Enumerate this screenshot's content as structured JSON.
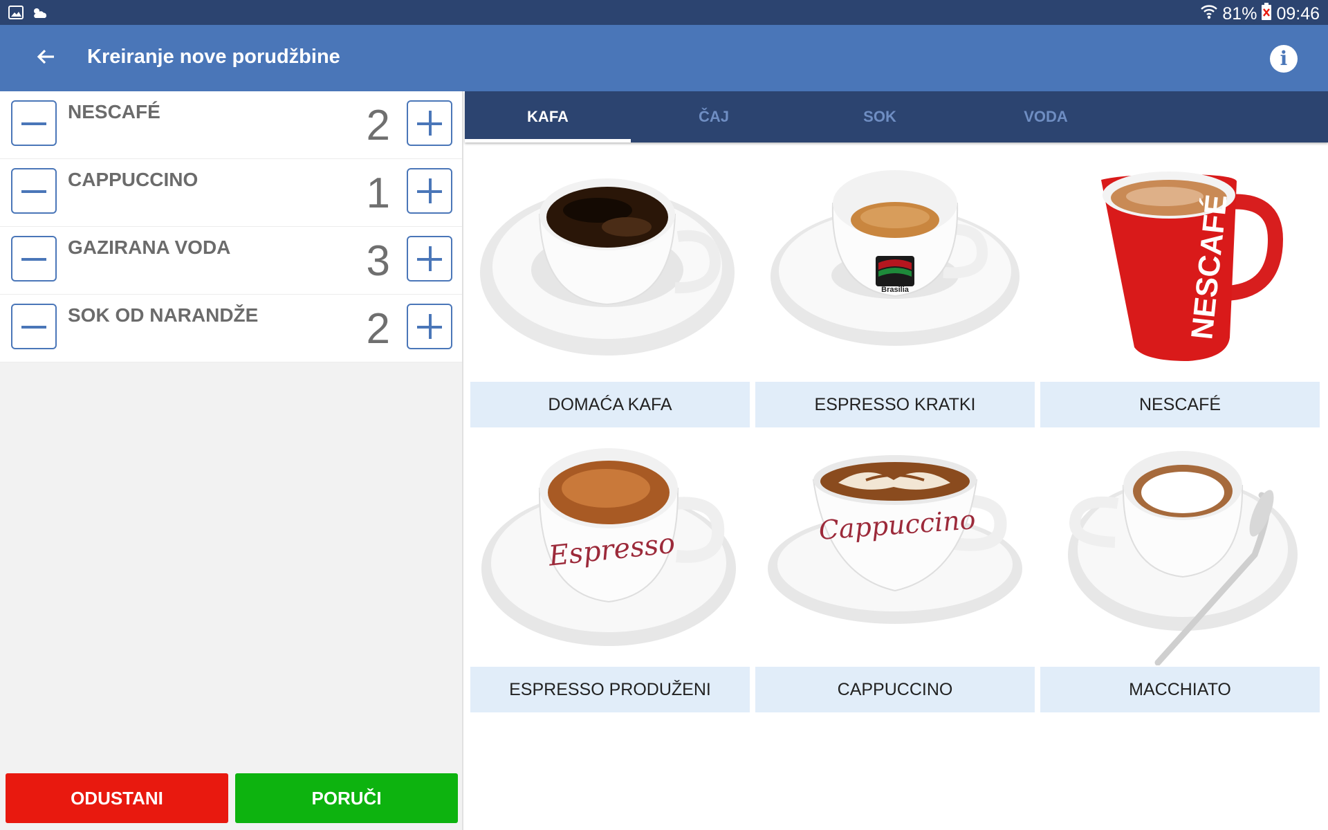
{
  "status_bar": {
    "battery": "81%",
    "time": "09:46"
  },
  "app_bar": {
    "title": "Kreiranje nove porudžbine"
  },
  "order_items": [
    {
      "name": "NESCAFÉ",
      "qty": "2"
    },
    {
      "name": "CAPPUCCINO",
      "qty": "1"
    },
    {
      "name": "GAZIRANA VODA",
      "qty": "3"
    },
    {
      "name": "SOK OD NARANDŽE",
      "qty": "2"
    }
  ],
  "actions": {
    "cancel": "ODUSTANI",
    "order": "PORUČI"
  },
  "tabs": [
    {
      "label": "KAFA",
      "active": true
    },
    {
      "label": "ČAJ",
      "active": false
    },
    {
      "label": "SOK",
      "active": false
    },
    {
      "label": "VODA",
      "active": false
    }
  ],
  "products": [
    {
      "name": "DOMAĆA KAFA"
    },
    {
      "name": "ESPRESSO KRATKI",
      "cup_text": "Brasilia"
    },
    {
      "name": "NESCAFÉ",
      "cup_text": "NESCAFÉ"
    },
    {
      "name": "ESPRESSO PRODUŽENI",
      "cup_text": "Espresso"
    },
    {
      "name": "CAPPUCCINO",
      "cup_text": "Cappuccino"
    },
    {
      "name": "MACCHIATO"
    }
  ],
  "colors": {
    "status_bar": "#2c4470",
    "app_bar": "#4a76b8",
    "tab_bar": "#2c4470",
    "cancel": "#e8190f",
    "order": "#0db30f",
    "label_bg": "#e1edf9"
  }
}
